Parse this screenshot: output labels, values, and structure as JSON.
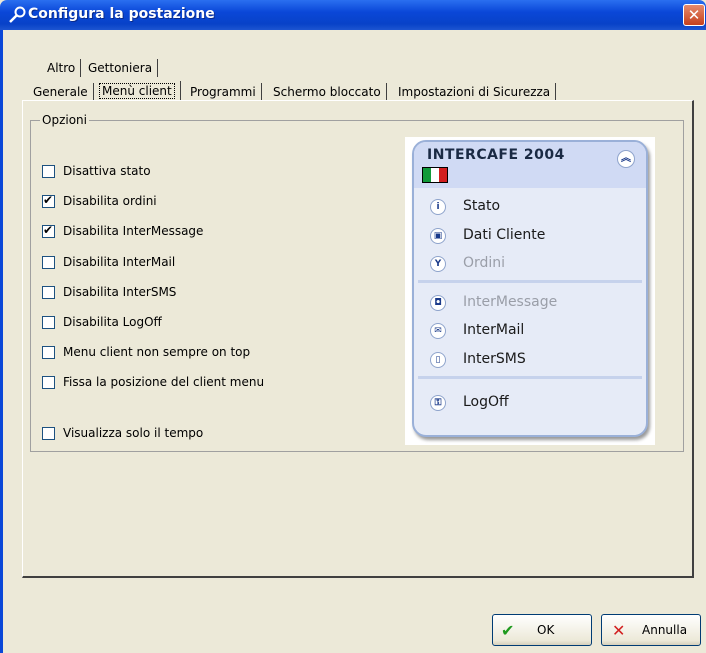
{
  "window": {
    "title": "Configura la postazione"
  },
  "tabs_row1": [
    {
      "label": "Altro"
    },
    {
      "label": "Gettoniera"
    }
  ],
  "tabs_row2": [
    {
      "label": "Generale"
    },
    {
      "label": "Menù client"
    },
    {
      "label": "Programmi"
    },
    {
      "label": "Schermo bloccato"
    },
    {
      "label": "Impostazioni di Sicurezza"
    }
  ],
  "options_group": {
    "title": "Opzioni"
  },
  "options": [
    {
      "label": "Disattiva stato",
      "checked": false
    },
    {
      "label": "Disabilita ordini",
      "checked": true
    },
    {
      "label": "Disabilita InterMessage",
      "checked": true
    },
    {
      "label": "Disabilita InterMail",
      "checked": false
    },
    {
      "label": "Disabilita InterSMS",
      "checked": false
    },
    {
      "label": "Disabilita LogOff",
      "checked": false
    },
    {
      "label": "Menu client non sempre on top",
      "checked": false
    },
    {
      "label": "Fissa la posizione del client menu",
      "checked": false
    },
    {
      "label": "Visualizza solo il tempo",
      "checked": false
    }
  ],
  "preview": {
    "title": "INTERCAFE 2004",
    "items": [
      {
        "label": "Stato",
        "icon": "info-icon",
        "glyph": "i",
        "disabled": false
      },
      {
        "label": "Dati Cliente",
        "icon": "client-data-icon",
        "glyph": "▣",
        "disabled": false
      },
      {
        "label": "Ordini",
        "icon": "orders-icon",
        "glyph": "Y",
        "disabled": true
      },
      {
        "label": "InterMessage",
        "icon": "message-icon",
        "glyph": "◘",
        "disabled": true
      },
      {
        "label": "InterMail",
        "icon": "mail-icon",
        "glyph": "✉",
        "disabled": false
      },
      {
        "label": "InterSMS",
        "icon": "phone-icon",
        "glyph": "▯",
        "disabled": false
      },
      {
        "label": "LogOff",
        "icon": "key-icon",
        "glyph": "⚿",
        "disabled": false
      }
    ],
    "flag_colors": [
      "#119a3a",
      "#ffffff",
      "#d21f1f"
    ]
  },
  "buttons": {
    "ok": "OK",
    "cancel": "Annulla"
  },
  "colors": {
    "titlebar": "#0a47d8",
    "ok_check": "#1f9a1f",
    "cancel_x": "#d21f1f"
  }
}
